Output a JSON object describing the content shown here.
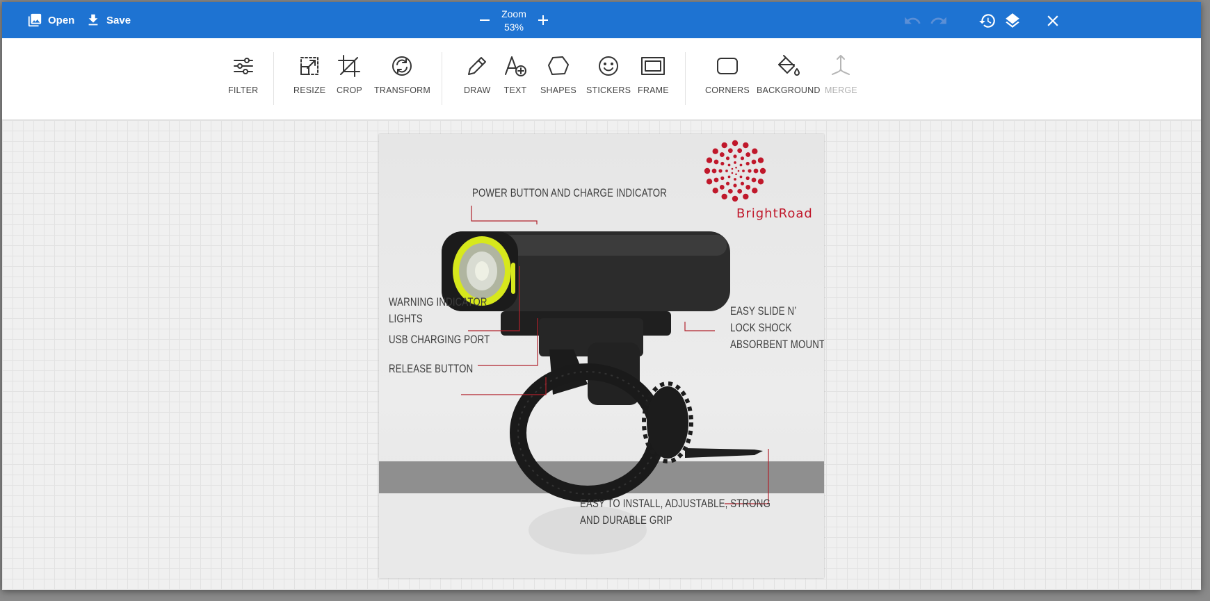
{
  "topbar": {
    "open_label": "Open",
    "save_label": "Save",
    "zoom_title": "Zoom",
    "zoom_value": "53%"
  },
  "tools": {
    "filter": "FILTER",
    "resize": "RESIZE",
    "crop": "CROP",
    "transform": "TRANSFORM",
    "draw": "DRAW",
    "text": "TEXT",
    "shapes": "SHAPES",
    "stickers": "STICKERS",
    "frame": "FRAME",
    "corners": "CORNERS",
    "background": "BACKGROUND",
    "merge": "MERGE"
  },
  "image": {
    "brand": "BrightRoad",
    "callouts": {
      "power": "POWER BUTTON AND CHARGE INDICATOR",
      "warning_1": "WARNING INDICATOR",
      "warning_2": "LIGHTS",
      "usb": "USB CHARGING PORT",
      "release": "RELEASE BUTTON",
      "mount_1": "EASY SLIDE N’",
      "mount_2": "LOCK SHOCK",
      "mount_3": "ABSORBENT MOUNT",
      "grip_1": "EASY TO INSTALL, ADJUSTABLE, STRONG",
      "grip_2": "AND DURABLE GRIP"
    }
  },
  "colors": {
    "topbar": "#1e73d2",
    "brand_red": "#c0182b",
    "lens_yellow": "#d7e81c"
  }
}
